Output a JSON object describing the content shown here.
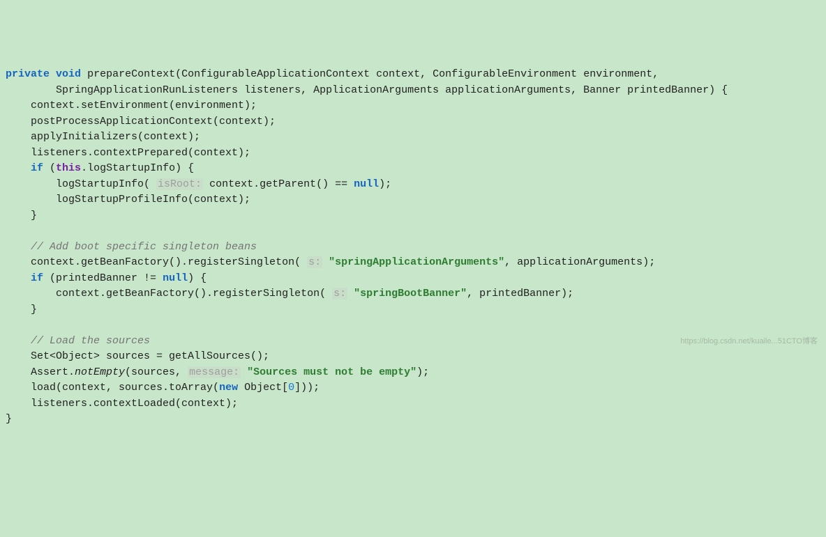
{
  "code": {
    "kw_private": "private",
    "kw_void": "void",
    "kw_if": "if",
    "kw_this": "this",
    "kw_null": "null",
    "kw_new": "new",
    "method_name": "prepareContext",
    "sig_part1": "(ConfigurableApplicationContext context, ConfigurableEnvironment environment,",
    "sig_part2": "        SpringApplicationRunListeners listeners, ApplicationArguments applicationArguments, Banner printedBanner) {",
    "line3": "    context.setEnvironment(environment);",
    "line4": "    postProcessApplicationContext(context);",
    "line5": "    applyInitializers(context);",
    "line6": "    listeners.contextPrepared(context);",
    "if_open": " (",
    "log_startup_field": ".logStartupInfo",
    "if_close_brace": ") {",
    "line8a": "        logStartupInfo( ",
    "hint_isRoot": "isRoot:",
    "line8b": " context.getParent() == ",
    "line8c": ");",
    "line9": "        logStartupProfileInfo(context);",
    "brace_close": "    }",
    "comment1": "    // Add boot specific singleton beans",
    "line12a": "    context.getBeanFactory().registerSingleton( ",
    "hint_s": "s:",
    "string1": "\"springApplicationArguments\"",
    "line12b": ", applicationArguments);",
    "line13a": " (printedBanner != ",
    "line13b": ") {",
    "line14a": "        context.getBeanFactory().registerSingleton( ",
    "string2": "\"springBootBanner\"",
    "line14b": ", printedBanner);",
    "comment2": "    // Load the sources",
    "line17": "    Set<Object> sources = getAllSources();",
    "line18a": "    Assert.",
    "notEmpty": "notEmpty",
    "line18b": "(sources, ",
    "hint_message": "message:",
    "string3": "\"Sources must not be empty\"",
    "line18c": ");",
    "line19a": "    load(context, sources.toArray(",
    "line19b": " Object[",
    "zero": "0",
    "line19c": "]));",
    "line20": "    listeners.contextLoaded(context);",
    "final_brace": "}"
  },
  "watermark": "https://blog.csdn.net/kuaile...51CTO博客"
}
